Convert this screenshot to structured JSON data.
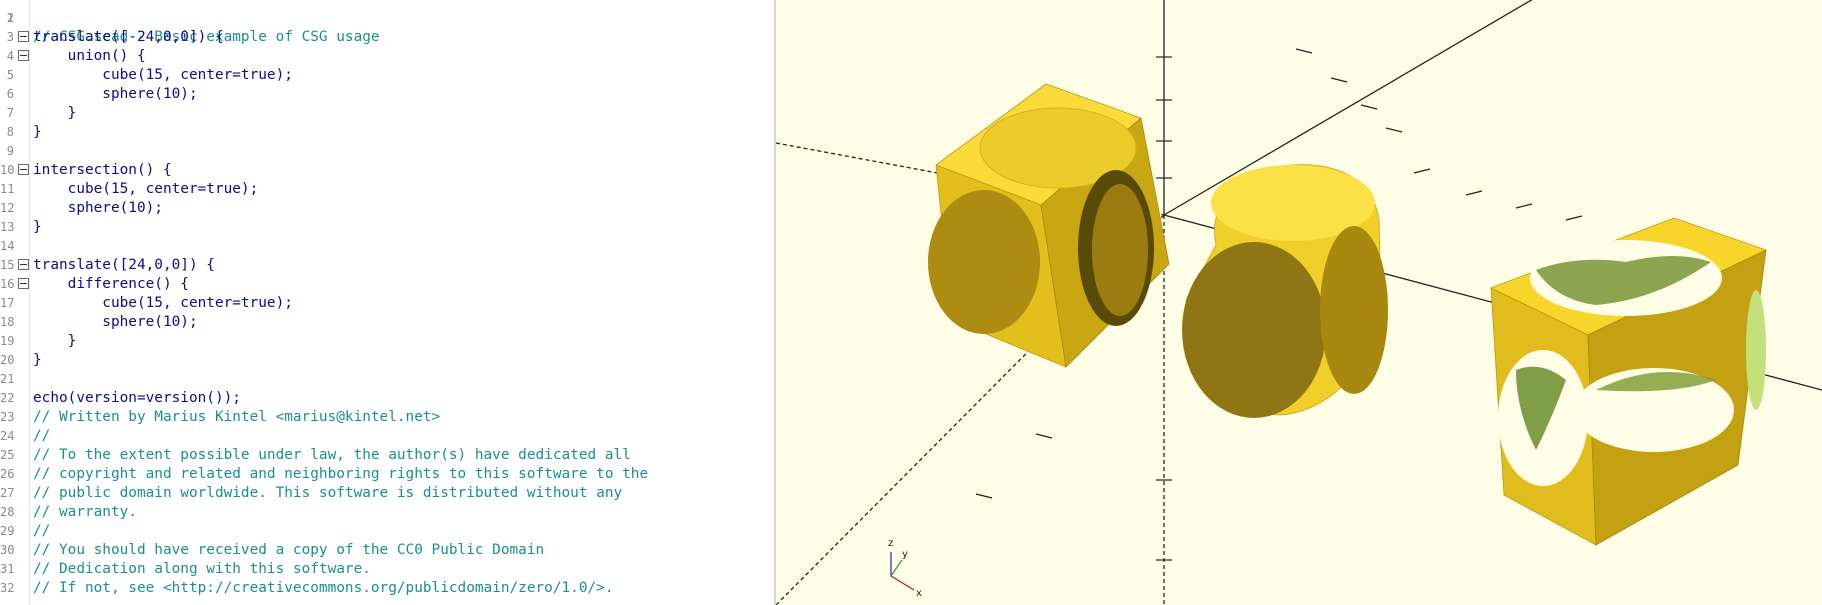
{
  "editor": {
    "lines": [
      {
        "n": "2",
        "t": ""
      },
      {
        "n": "3",
        "t": "translate([-24,0,0]) {"
      },
      {
        "n": "4",
        "t": "    union() {"
      },
      {
        "n": "5",
        "t": "        cube(15, center=true);"
      },
      {
        "n": "6",
        "t": "        sphere(10);"
      },
      {
        "n": "7",
        "t": "    }"
      },
      {
        "n": "8",
        "t": "}"
      },
      {
        "n": "9",
        "t": ""
      },
      {
        "n": "10",
        "t": "intersection() {"
      },
      {
        "n": "11",
        "t": "    cube(15, center=true);"
      },
      {
        "n": "12",
        "t": "    sphere(10);"
      },
      {
        "n": "13",
        "t": "}"
      },
      {
        "n": "14",
        "t": ""
      },
      {
        "n": "15",
        "t": "translate([24,0,0]) {"
      },
      {
        "n": "16",
        "t": "    difference() {"
      },
      {
        "n": "17",
        "t": "        cube(15, center=true);"
      },
      {
        "n": "18",
        "t": "        sphere(10);"
      },
      {
        "n": "19",
        "t": "    }"
      },
      {
        "n": "20",
        "t": "}"
      },
      {
        "n": "21",
        "t": ""
      },
      {
        "n": "22",
        "t": "echo(version=version());"
      },
      {
        "n": "23",
        "t": "// Written by Marius Kintel <marius@kintel.net>"
      },
      {
        "n": "24",
        "t": "//"
      },
      {
        "n": "25",
        "t": "// To the extent possible under law, the author(s) have dedicated all"
      },
      {
        "n": "26",
        "t": "// copyright and related and neighboring rights to this software to the"
      },
      {
        "n": "27",
        "t": "// public domain worldwide. This software is distributed without any"
      },
      {
        "n": "28",
        "t": "// warranty."
      },
      {
        "n": "29",
        "t": "//"
      },
      {
        "n": "30",
        "t": "// You should have received a copy of the CC0 Public Domain"
      },
      {
        "n": "31",
        "t": "// Dedication along with this software."
      },
      {
        "n": "32",
        "t": "// If not, see <http://creativecommons.org/publicdomain/zero/1.0/>."
      }
    ],
    "first_line_partial": "// CSG.scad - Basic example of CSG usage"
  },
  "viewport": {
    "background": "#fffde6",
    "model_color": "#f9d72c",
    "axis_labels": {
      "x": "x",
      "y": "y",
      "z": "z"
    }
  }
}
